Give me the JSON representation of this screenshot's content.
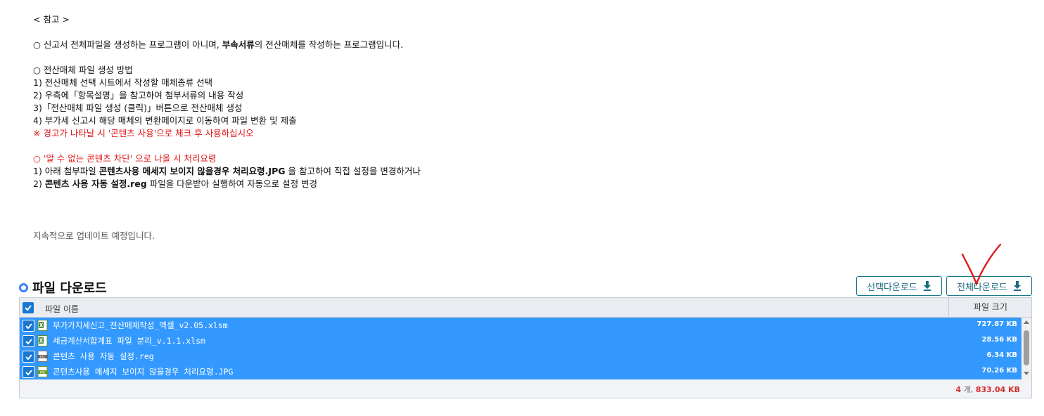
{
  "notice": {
    "heading": "< 참고 >",
    "para1_pre": "○ 신고서 전체파일을 생성하는 프로그램이 아니며, ",
    "para1_bold": "부속서류",
    "para1_post": "의 전산매체를 작성하는 프로그램입니다.",
    "method_title": "○ 전산매체 파일 생성 방법",
    "step1": "1) 전산매체 선택 시트에서 작성할 매체종류 선택",
    "step2": "2) 우측에「항목설명」을 참고하여 첨부서류의 내용 작성",
    "step3": "3)「전산매체 파일 생성 (클릭)」버튼으로 전산매체 생성",
    "step4": "4) 부가세 신고시 해당 매체의 변환페이지로 이동하여 파일 변환 및 제출",
    "warning": "※ 경고가 나타날 시 '콘텐츠 사용'으로 체크 후 사용하십시오",
    "blocked_title": "○ '알 수 없는 콘텐츠 차단' 으로 나올 시 처리요령",
    "fix1_pre": "1) 아래 첨부파일 ",
    "fix1_bold": "콘텐츠사용 메세지 보이지 않을경우 처리요령.JPG",
    "fix1_post": " 을 참고하여 직접 설정을 변경하거나",
    "fix2_pre": "2) ",
    "fix2_bold": "콘텐츠 사용 자동 설정.reg",
    "fix2_post": " 파일을 다운받아 실행하여 자동으로 설정 변경"
  },
  "update_text": "지속적으로 업데이트 예정입니다.",
  "download": {
    "title": "파일 다운로드",
    "select_button": "선택다운로드",
    "all_button": "전체다운로드",
    "col_name": "파일 이름",
    "col_size": "파일 크기",
    "files": [
      {
        "name": "부가가치세신고_전산매체작성_엑셀_v2.05.xlsm",
        "size": "727.87 KB",
        "type": "xlsx",
        "checked": true
      },
      {
        "name": "세금계산서합계표 파일 분리_v.1.1.xlsm",
        "size": "28.56 KB",
        "type": "xlsx",
        "checked": true
      },
      {
        "name": "콘텐츠 사용 자동 설정.reg",
        "size": "6.34 KB",
        "type": "etc",
        "checked": true
      },
      {
        "name": "콘텐츠사용 메세지 보이지 않을경우 처리요령.JPG",
        "size": "70.26 KB",
        "type": "jpg",
        "checked": true
      }
    ],
    "summary_count": "4",
    "summary_count_unit": " 개, ",
    "summary_total": "833.04 KB"
  },
  "colors": {
    "selection": "#3399ff",
    "checkbox": "#1976d2",
    "button_border": "#1c7a8c",
    "warning": "#e0191b",
    "annotation": "#e0191b"
  }
}
